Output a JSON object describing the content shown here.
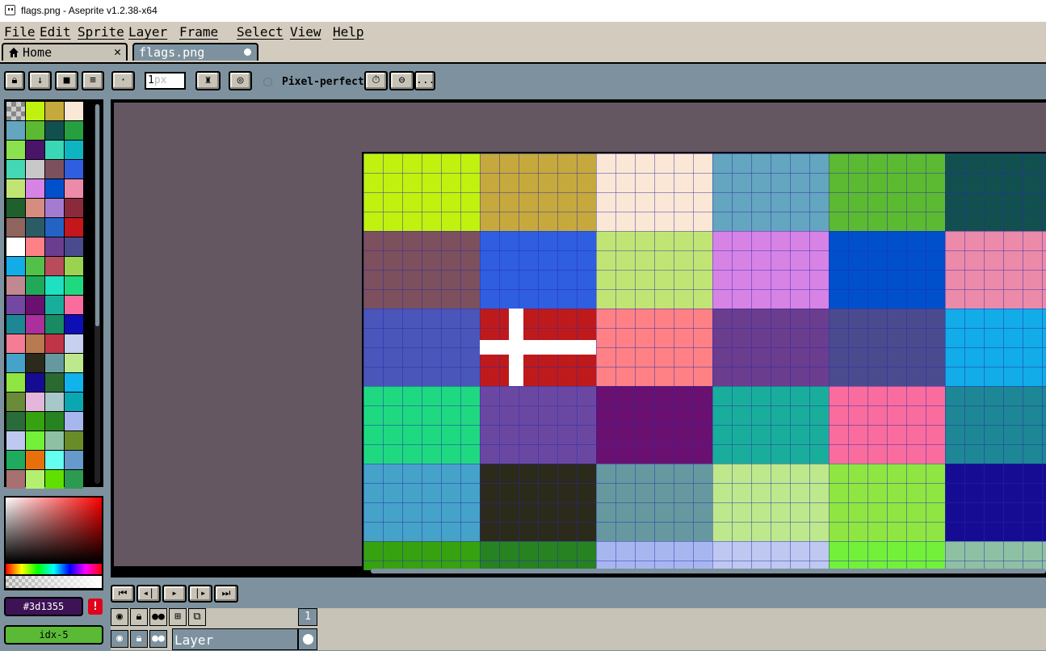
{
  "window": {
    "title": "flags.png - Aseprite v1.2.38-x64"
  },
  "menu": [
    "File",
    "Edit",
    "Sprite",
    "Layer",
    "Frame",
    "Select",
    "View",
    "Help"
  ],
  "tabs": {
    "home": "Home",
    "file": "flags.png"
  },
  "context_bar": {
    "brush_size_value": "1",
    "brush_size_unit": "px",
    "pixel_perfect_label": "Pixel-perfect",
    "more_label": "..."
  },
  "palette_colors": [
    "checker",
    "#c0f10f",
    "#c6a93c",
    "#fbe7d5",
    "#64a5bf",
    "#5cb932",
    "#12504f",
    "#269f41",
    "#89e24e",
    "#4a1468",
    "#39d7b6",
    "#0db4c2",
    "#45d8b4",
    "#c8c8c8",
    "#7c505c",
    "#2f5ee0",
    "#c1e574",
    "#d783e6",
    "#0050cc",
    "#ec8aa9",
    "#20602c",
    "#d68d7f",
    "#a57bd2",
    "#8c2a3c",
    "#8f6560",
    "#2b5c66",
    "#2363c4",
    "#c3171b",
    "#ffffff",
    "#ff8185",
    "#6b3d8e",
    "#4a4a8e",
    "#12ace9",
    "#51c14a",
    "#b84c5a",
    "#9bd250",
    "#c08890",
    "#22a859",
    "#1fe0c0",
    "#1ed980",
    "#7348a2",
    "#6a1070",
    "#19ae9b",
    "#f96c9d",
    "#1e8795",
    "#ab2f9c",
    "#198b63",
    "#0e0eb7",
    "#f47c94",
    "#b87a4e",
    "#c03448",
    "#c8d0f0",
    "#45a2c8",
    "#2b2a1b",
    "#65999f",
    "#bee88c",
    "#8fe541",
    "#160c93",
    "#2a6930",
    "#11b3ec",
    "#6a8c38",
    "#e4b6dc",
    "#a7c8c8",
    "#0aa7b3",
    "#2a6b3a",
    "#37a210",
    "#278222",
    "#a8b6f0",
    "#bec8f0",
    "#72f03a",
    "#8ec0a4",
    "#6a8c28",
    "#1eab60",
    "#e8700a",
    "#65fff0",
    "#6699cc",
    "#a87070",
    "#b4f070",
    "#60e000",
    "#2c9a50"
  ],
  "flags": [
    [
      "#c0f10f",
      "#c6a93c",
      "#fbe7d5",
      "#64a5bf",
      "#5cb932",
      "#12504f"
    ],
    [
      "#7c505c",
      "#2f5ee0",
      "#c1e574",
      "#d783e6",
      "#0050cc",
      "#ec8aa9"
    ],
    [
      "#4a56b9",
      "denmark",
      "#ff8185",
      "#6b3d8e",
      "#4a4a8e",
      "#12ace9"
    ],
    [
      "#1ed980",
      "#6a48a2",
      "#6a1070",
      "#19ae9b",
      "#f96c9d",
      "#1e8795"
    ],
    [
      "#45a2c8",
      "#2b2a1b",
      "#65999f",
      "#bee88c",
      "#8fe541",
      "#160c93"
    ],
    [
      "#37a210",
      "#278222",
      "#a8b6f0",
      "#bec8f0",
      "#72f03a",
      "#8ec0a4"
    ]
  ],
  "colors": {
    "foreground": "#3d1355",
    "foreground_label": "#3d1355",
    "background": "#5bba35",
    "background_label": "idx-5"
  },
  "timeline": {
    "frame_number": "1",
    "layer_name": "Layer"
  }
}
